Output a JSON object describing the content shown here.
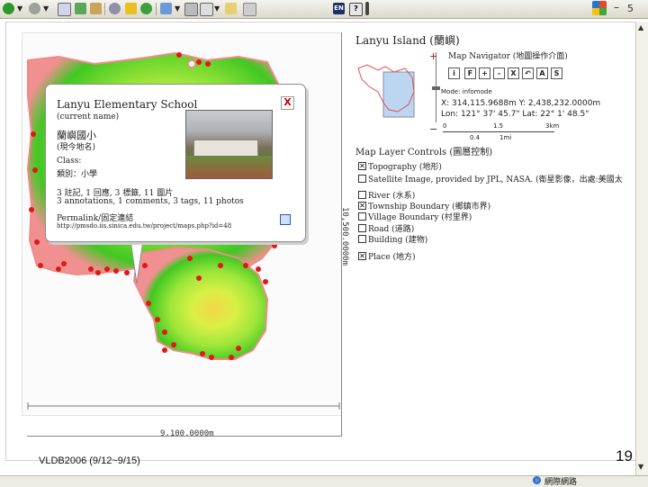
{
  "map": {
    "title": "Lanyu Island (蘭嶼)",
    "horizontal_scale": "9,100.0000m",
    "vertical_scale": "10,500.0000m"
  },
  "popup": {
    "title": "Lanyu Elementary School",
    "current_name_label": "(current name)",
    "chinese_name": "蘭嶼國小",
    "chinese_name_label": "(現今地名)",
    "class_label": "Class:",
    "class_value": "類別：小學",
    "stats_zh": "3 註記, 1 回應, 3 標籤, 11 圖片",
    "stats_en": "3 annotations, 1 comments, 3 tags, 11 photos",
    "permalink_label": "Permalink/固定連結",
    "permalink_url": "http://pmsdo.iis.sinica.edu.tw/project/maps.php?id=48",
    "close_label": "X"
  },
  "navigator": {
    "title": "Map Navigator (地圖操作介面)",
    "buttons": [
      "i",
      "F",
      "+",
      "-",
      "X",
      "↶",
      "A",
      "S"
    ],
    "mode": "Mode: infomode",
    "coords_xy": "X: 314,115.9688m Y: 2,438,232.0000m",
    "coords_lonlat": "Lon: 121° 37' 45.7\" Lat: 22° 1' 48.5\"",
    "zoom_plus": "+",
    "zoom_minus": "−",
    "scale_ticks_top": [
      "0",
      "1.5",
      "3km"
    ],
    "scale_ticks_bottom": [
      "0.4",
      "1mi"
    ]
  },
  "layers": {
    "title": "Map Layer Controls (圖層控制)",
    "items": [
      {
        "label": "Topography (地形)",
        "checked": true
      },
      {
        "label": "Satellite Image, provided by JPL, NASA. (衛星影像，出處:美國太",
        "checked": false
      },
      {
        "label": "River (水系)",
        "checked": false
      },
      {
        "label": "Township Boundary (鄉鎮市界)",
        "checked": true
      },
      {
        "label": "Village Boundary (村里界)",
        "checked": false
      },
      {
        "label": "Road (道路)",
        "checked": false
      },
      {
        "label": "Building (建物)",
        "checked": false
      },
      {
        "label": "Place (地方)",
        "checked": true
      }
    ]
  },
  "footer": {
    "slide_text": "VLDB2006 (9/12~9/15)",
    "slide_number": "19",
    "status_text": "網際網路"
  },
  "colors": {
    "topo_low": "#3cc81e",
    "topo_mid": "#c8f040",
    "topo_high": "#f0e050",
    "place_marker": "#e01818",
    "boundary": "#f08080"
  }
}
